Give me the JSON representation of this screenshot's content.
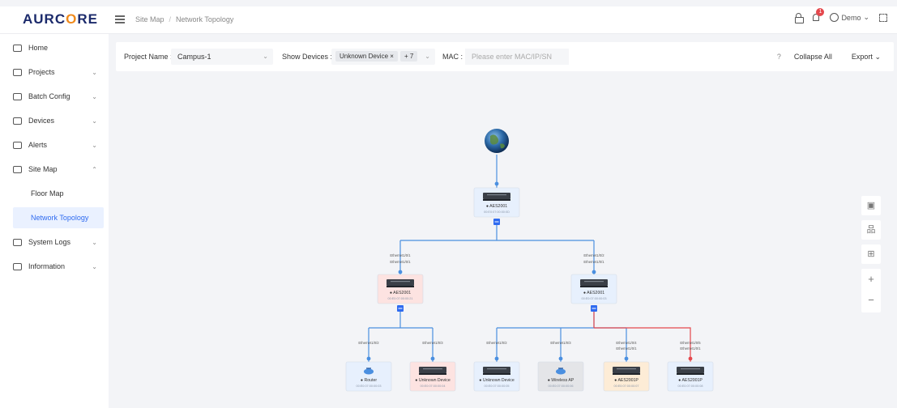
{
  "header": {
    "logo": "AURCORE",
    "breadcrumb": [
      "Site Map",
      "Network Topology"
    ],
    "notification_count": "1",
    "user": "Demo"
  },
  "sidebar": {
    "items": [
      {
        "label": "Home",
        "icon": "home-icon"
      },
      {
        "label": "Projects",
        "icon": "projects-icon"
      },
      {
        "label": "Batch Config",
        "icon": "batch-config-icon"
      },
      {
        "label": "Devices",
        "icon": "devices-icon"
      },
      {
        "label": "Alerts",
        "icon": "alerts-icon"
      },
      {
        "label": "Site Map",
        "icon": "site-map-icon"
      },
      {
        "label": "System Logs",
        "icon": "system-logs-icon"
      },
      {
        "label": "Information",
        "icon": "information-icon"
      }
    ],
    "sub_items": [
      "Floor Map",
      "Network Topology"
    ],
    "active": "Network Topology"
  },
  "filter": {
    "project_label": "Project Name :",
    "project_value": "Campus-1",
    "devices_label": "Show Devices :",
    "device_tag": "Unknown Device",
    "device_more": "+ 7",
    "mac_label": "MAC :",
    "mac_placeholder": "Please enter MAC/IP/SN",
    "help": "?",
    "collapse_label": "Collapse All",
    "export_label": "Export"
  },
  "topology": {
    "root": {
      "name": "AES2001",
      "mac": "00:E0:07:00:00:0D"
    },
    "level1": [
      {
        "name": "AES2001",
        "mac": "00:E0:07:00:00:21",
        "status": "alarm",
        "port_up": "Ethernet1/0/1",
        "port_down": "Ethernet1/0/1"
      },
      {
        "name": "AES2001",
        "mac": "00:E0:07:00:00:03",
        "status": "normal",
        "port_up": "Ethernet1/0/2",
        "port_down": "Ethernet1/0/1"
      }
    ],
    "level2": [
      {
        "name": "Router",
        "mac": "00:E0:07:00:00:03",
        "status": "normal",
        "port": "Ethernet1/0/2",
        "port2": "",
        "kind": "router"
      },
      {
        "name": "Unknown Device",
        "mac": "00:E0:07:00:00:04",
        "status": "alarm",
        "port": "Ethernet1/0/3",
        "port2": "",
        "kind": "switch"
      },
      {
        "name": "Unknown Device",
        "mac": "00:E0:07:00:00:05",
        "status": "normal",
        "port": "Ethernet1/0/2",
        "port2": "",
        "kind": "switch"
      },
      {
        "name": "Wireless AP",
        "mac": "00:E0:07:00:00:06",
        "status": "offline",
        "port": "Ethernet1/0/3",
        "port2": "",
        "kind": "router"
      },
      {
        "name": "AES2001P",
        "mac": "00:E0:07:00:00:07",
        "status": "warning",
        "port": "Ethernet1/0/4",
        "port2": "Ethernet1/0/1",
        "kind": "switch"
      },
      {
        "name": "AES2001P",
        "mac": "00:E0:07:00:00:08",
        "status": "normal",
        "port": "Ethernet1/0/5",
        "port2": "Ethernet1/0/1",
        "kind": "switch"
      }
    ]
  },
  "tools": {
    "zoom_in": "+",
    "zoom_out": "−"
  },
  "colors": {
    "accent": "#2f6bf0",
    "link": "#4a8fe0",
    "alert_link": "#e5484d",
    "alarm_bg": "#fde3e1",
    "warning_bg": "#fdecd6",
    "offline_bg": "#e4e5e8",
    "normal_bg": "#e7f0fd"
  }
}
